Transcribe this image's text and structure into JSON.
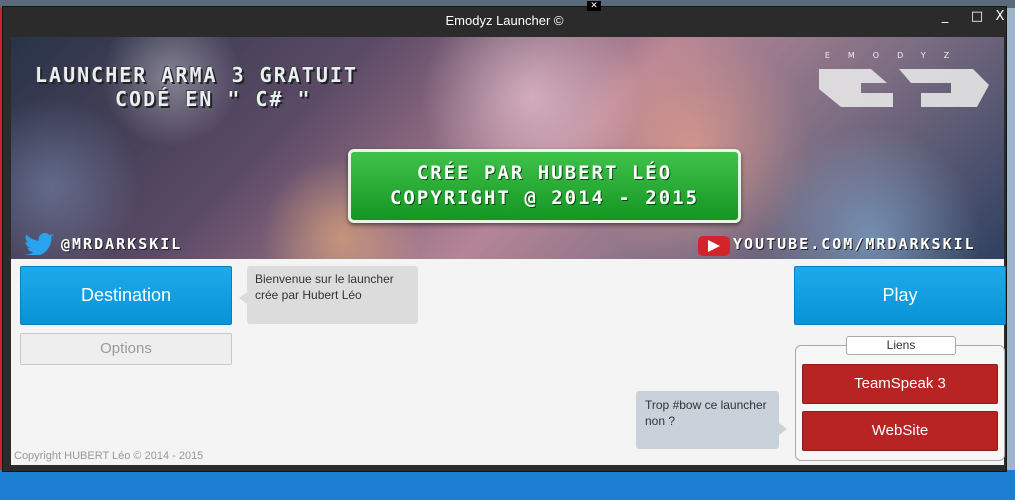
{
  "window": {
    "title": "Emodyz Launcher ©",
    "minimize_glyph": "_",
    "maximize_glyph": "□",
    "close_glyph": "X"
  },
  "banner": {
    "line1": "LAUNCHER ARMA 3 GRATUIT",
    "line2": "CODÉ EN \" C# \"",
    "logo_letters": "EMODYZ",
    "credit_line1": "CRÉE PAR HUBERT LÉO",
    "credit_line2": "COPYRIGHT @ 2014 - 2015",
    "twitter_handle": "@MRDARKSKIL",
    "youtube_url": "YOUTUBE.COM/MRDARKSKIL"
  },
  "buttons": {
    "destination": "Destination",
    "options": "Options",
    "play": "Play"
  },
  "bubbles": {
    "welcome": "Bienvenue sur le launcher crée par Hubert Léo",
    "bow": "Trop #bow ce launcher non ?"
  },
  "links": {
    "label": "Liens",
    "teamspeak": "TeamSpeak 3",
    "website": "WebSite"
  },
  "footer": {
    "copyright": "Copyright HUBERT Léo © 2014 - 2015"
  },
  "colors": {
    "accent_blue": "#0793d6",
    "accent_red": "#b82323",
    "accent_green": "#159623"
  },
  "icons": [
    "twitter-icon",
    "youtube-icon",
    "emodyz-logo"
  ]
}
